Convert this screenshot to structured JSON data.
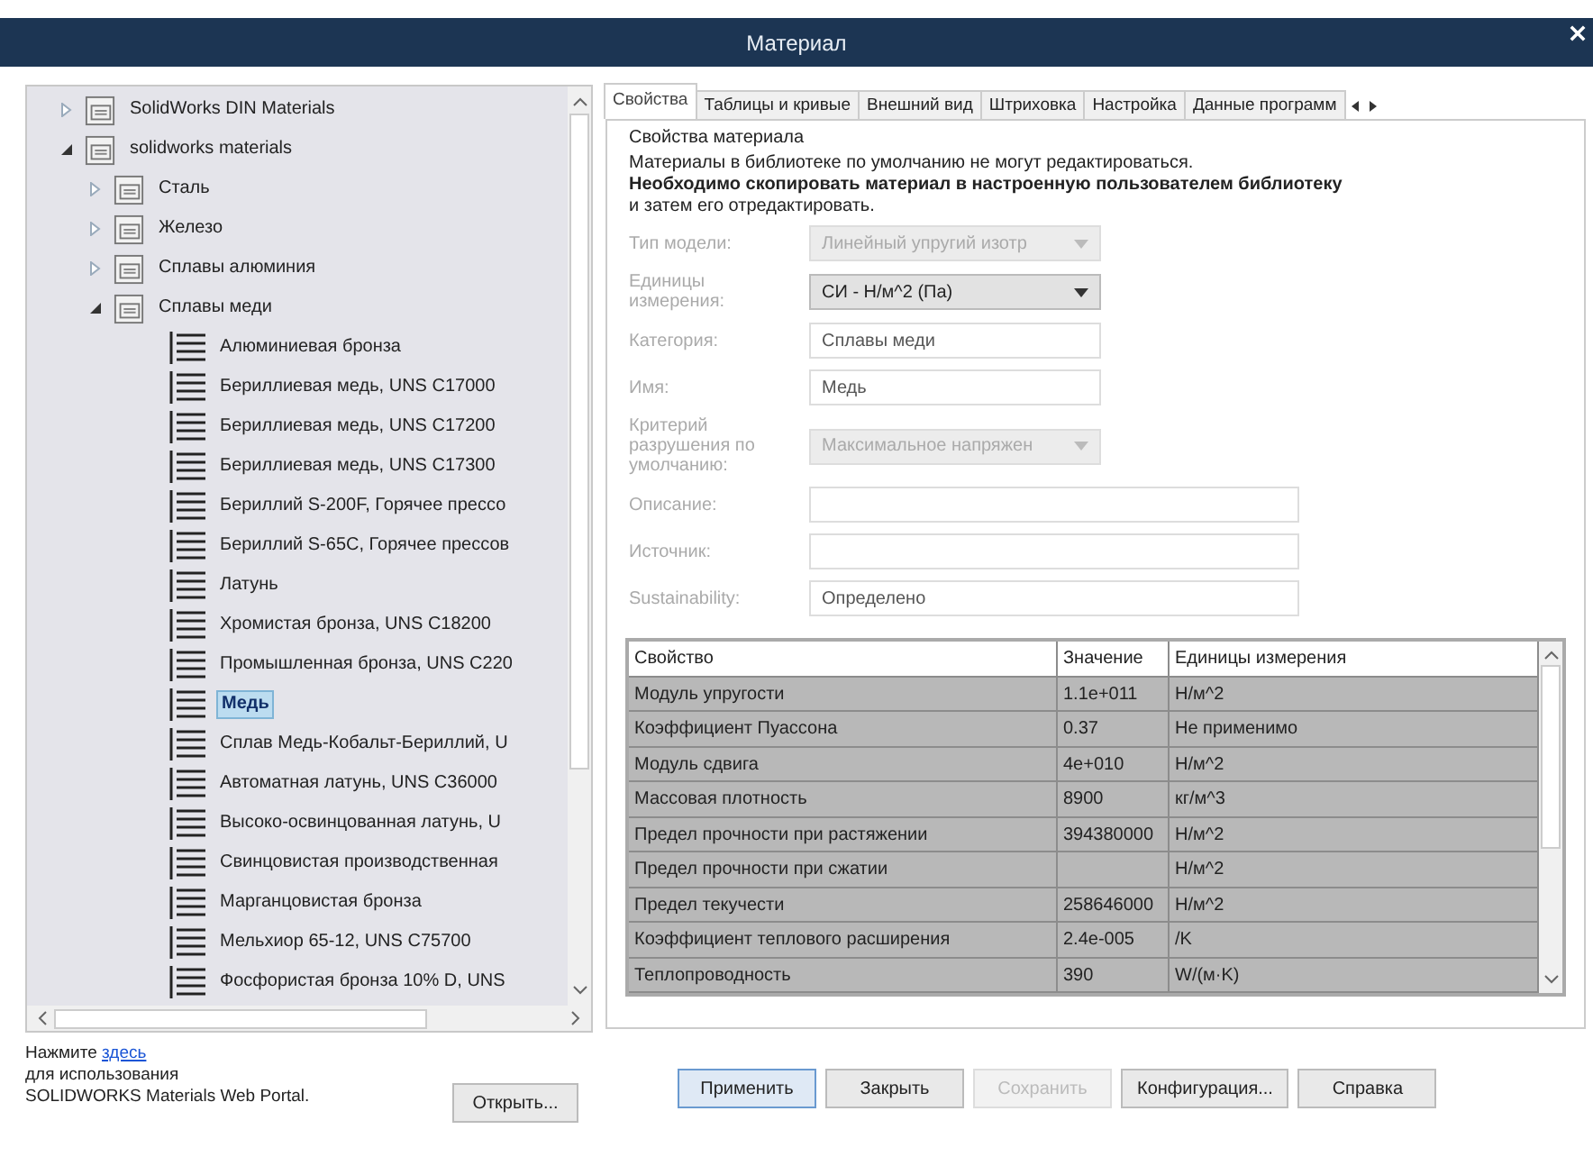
{
  "window": {
    "title": "Материал"
  },
  "tree": {
    "items": [
      {
        "kind": "folder",
        "label": "SolidWorks DIN Materials",
        "expanded": false,
        "selected": false
      },
      {
        "kind": "folder",
        "label": "solidworks materials",
        "expanded": true,
        "selected": false,
        "children": [
          {
            "kind": "folder",
            "label": "Сталь",
            "expanded": false,
            "selected": false
          },
          {
            "kind": "folder",
            "label": "Железо",
            "expanded": false,
            "selected": false
          },
          {
            "kind": "folder",
            "label": "Сплавы алюминия",
            "expanded": false,
            "selected": false
          },
          {
            "kind": "folder",
            "label": "Сплавы меди",
            "expanded": true,
            "selected": false,
            "children": [
              {
                "kind": "material",
                "label": "Алюминиевая бронза",
                "selected": false
              },
              {
                "kind": "material",
                "label": "Бериллиевая медь, UNS C17000",
                "selected": false
              },
              {
                "kind": "material",
                "label": "Бериллиевая медь, UNS C17200",
                "selected": false
              },
              {
                "kind": "material",
                "label": "Бериллиевая медь, UNS C17300",
                "selected": false
              },
              {
                "kind": "material",
                "label": "Бериллий S-200F, Горячее прессо",
                "selected": false
              },
              {
                "kind": "material",
                "label": "Бериллий S-65C, Горячее прессов",
                "selected": false
              },
              {
                "kind": "material",
                "label": "Латунь",
                "selected": false
              },
              {
                "kind": "material",
                "label": "Хромистая бронза, UNS C18200",
                "selected": false
              },
              {
                "kind": "material",
                "label": "Промышленная бронза, UNS C220",
                "selected": false
              },
              {
                "kind": "material",
                "label": "Медь",
                "selected": true
              },
              {
                "kind": "material",
                "label": "Сплав Медь-Кобальт-Бериллий, U",
                "selected": false
              },
              {
                "kind": "material",
                "label": "Автоматная латунь, UNS C36000",
                "selected": false
              },
              {
                "kind": "material",
                "label": "Высоко-освинцованная латунь, U",
                "selected": false
              },
              {
                "kind": "material",
                "label": "Свинцовистая производственная",
                "selected": false
              },
              {
                "kind": "material",
                "label": "Марганцовистая бронза",
                "selected": false
              },
              {
                "kind": "material",
                "label": "Мельхиор 65-12, UNS C75700",
                "selected": false
              },
              {
                "kind": "material",
                "label": "Фосфористая бронза 10% D, UNS",
                "selected": false
              }
            ]
          }
        ]
      }
    ]
  },
  "portal_note": {
    "prefix": "Нажмите",
    "link": "здесь",
    "rest": "для использования\nSOLIDWORKS Materials Web Portal."
  },
  "open_button": "Открыть...",
  "tabs": [
    {
      "label": "Свойства",
      "selected": true
    },
    {
      "label": "Таблицы и кривые",
      "selected": false
    },
    {
      "label": "Внешний вид",
      "selected": false
    },
    {
      "label": "Штриховка",
      "selected": false
    },
    {
      "label": "Настройка",
      "selected": false
    },
    {
      "label": "Данные программ",
      "selected": false
    }
  ],
  "properties": {
    "heading": "Свойства материала",
    "notice": "Материалы в библиотеке по умолчанию не могут редактироваться.\n**Необходимо скопировать материал в настроенную пользователем библиотеку**\nи затем его отредактировать.",
    "fields": [
      {
        "label": "Тип модели:",
        "kind": "dropdown",
        "value": "Линейный упругий изотр",
        "disabled": true,
        "wide": false
      },
      {
        "label": "Единицы измерения:",
        "kind": "dropdown",
        "value": "СИ - Н/м^2 (Па)",
        "disabled": false,
        "wide": false
      },
      {
        "label": "Категория:",
        "kind": "text",
        "value": "Сплавы меди",
        "disabled": false,
        "wide": false
      },
      {
        "label": "Имя:",
        "kind": "text",
        "value": "Медь",
        "disabled": false,
        "wide": false
      },
      {
        "label": "Критерий разрушения по умолчанию:",
        "kind": "dropdown",
        "value": "Максимальное напряжен",
        "disabled": true,
        "wide": false
      },
      {
        "label": "Описание:",
        "kind": "text",
        "disabled": false,
        "wide": true
      },
      {
        "label": "Источник:",
        "kind": "text",
        "disabled": false,
        "wide": true
      },
      {
        "label": "Sustainability:",
        "kind": "text",
        "value": "Определено",
        "disabled": false,
        "wide": true
      }
    ]
  },
  "table": {
    "columns": [
      "Свойство",
      "Значение",
      "Единицы измерения"
    ],
    "rows": [
      [
        "Модуль упругости",
        "1.1e+011",
        "Н/м^2"
      ],
      [
        "Коэффициент Пуассона",
        "0.37",
        "Не применимо"
      ],
      [
        "Модуль сдвига",
        "4e+010",
        "Н/м^2"
      ],
      [
        "Массовая плотность",
        "8900",
        "кг/м^3"
      ],
      [
        "Предел прочности при растяжении",
        "394380000",
        "Н/м^2"
      ],
      [
        "Предел прочности при сжатии",
        "",
        "Н/м^2"
      ],
      [
        "Предел текучести",
        "258646000",
        "Н/м^2"
      ],
      [
        "Коэффициент теплового расширения",
        "2.4e-005",
        "/K"
      ],
      [
        "Теплопроводность",
        "390",
        "W/(м·K)"
      ]
    ]
  },
  "buttons": [
    {
      "label": "Применить",
      "default": true,
      "disabled": false
    },
    {
      "label": "Закрыть",
      "default": false,
      "disabled": false
    },
    {
      "label": "Сохранить",
      "default": false,
      "disabled": true
    },
    {
      "label": "Конфигурация...",
      "default": false,
      "disabled": false
    },
    {
      "label": "Справка",
      "default": false,
      "disabled": false
    }
  ]
}
